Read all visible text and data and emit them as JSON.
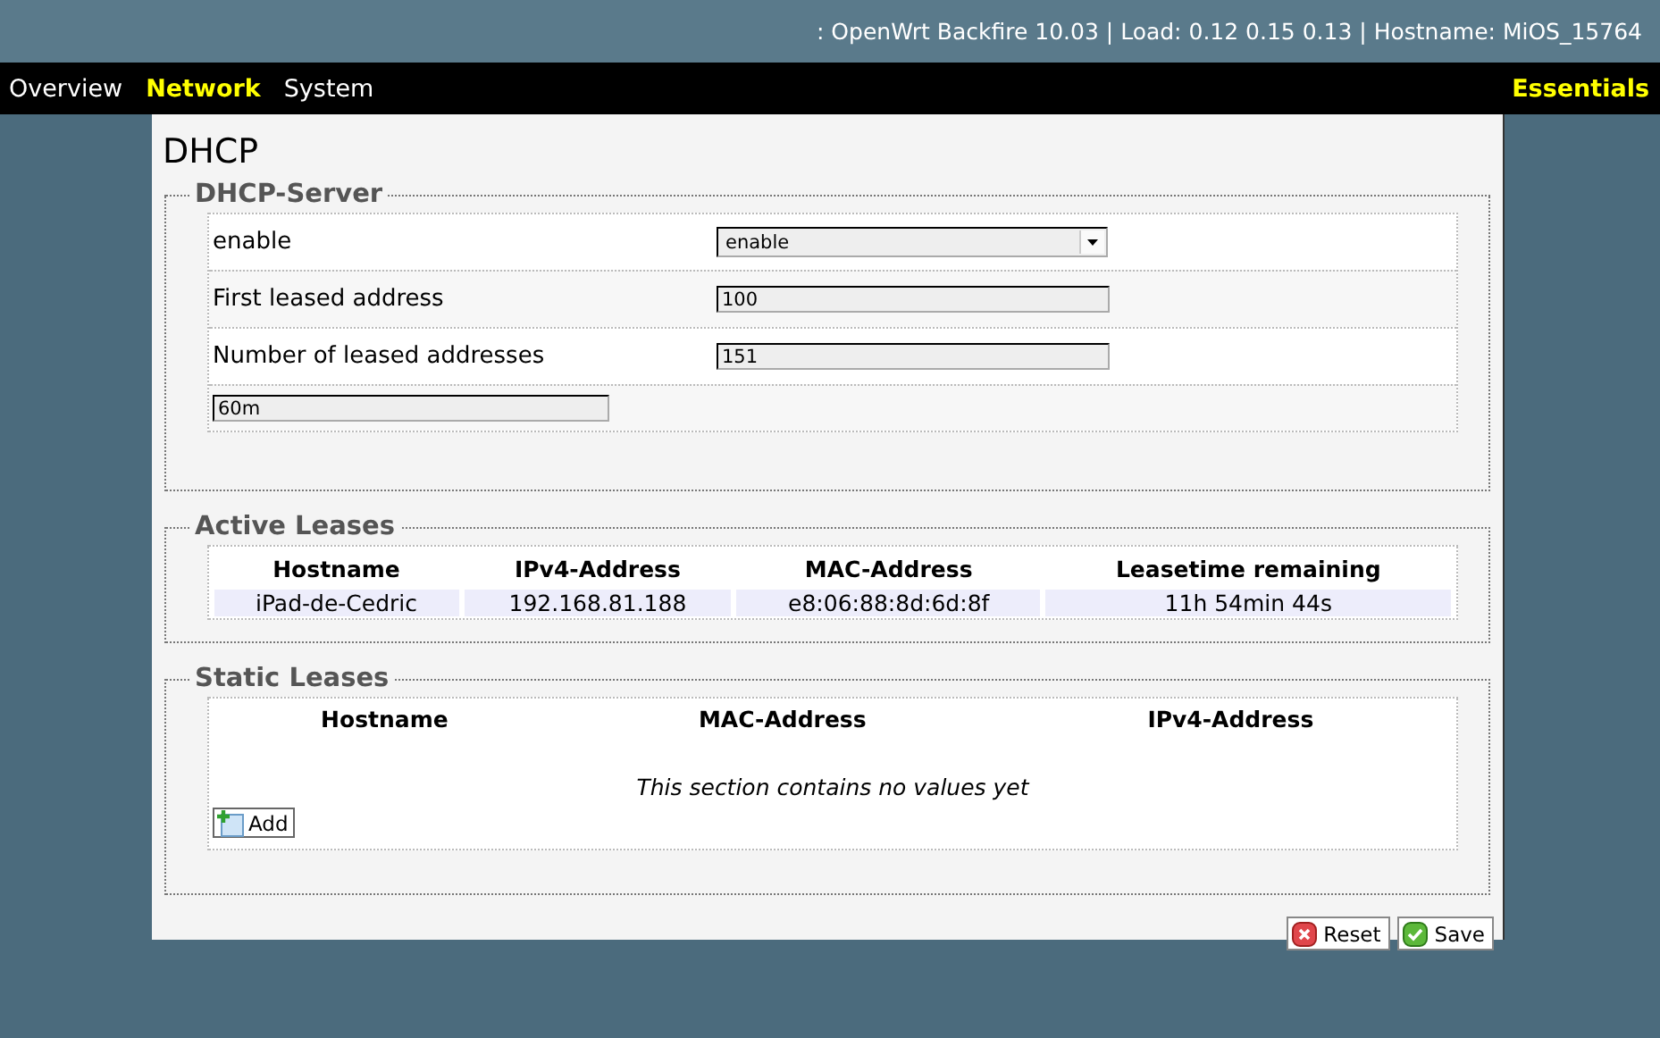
{
  "header": {
    "status": ": OpenWrt Backfire 10.03 | Load: 0.12 0.15 0.13 | Hostname: MiOS_15764"
  },
  "nav": {
    "items": [
      {
        "label": "Overview",
        "selected": false
      },
      {
        "label": "Network",
        "selected": true
      },
      {
        "label": "System",
        "selected": false
      }
    ],
    "mode": "Essentials"
  },
  "page": {
    "title": "DHCP"
  },
  "dhcp_server": {
    "legend": "DHCP-Server",
    "fields": [
      {
        "kind": "select",
        "label": "enable",
        "value": "enable"
      },
      {
        "kind": "text",
        "label": "First leased address",
        "value": "100"
      },
      {
        "kind": "text",
        "label": "Number of leased addresses",
        "value": "151"
      },
      {
        "kind": "text",
        "value": "60m"
      }
    ]
  },
  "active_leases": {
    "legend": "Active Leases",
    "columns": [
      "Hostname",
      "IPv4-Address",
      "MAC-Address",
      "Leasetime remaining"
    ],
    "rows": [
      [
        "iPad-de-Cedric",
        "192.168.81.188",
        "e8:06:88:8d:6d:8f",
        "11h 54min 44s"
      ]
    ]
  },
  "static_leases": {
    "legend": "Static Leases",
    "columns": [
      "Hostname",
      "MAC-Address",
      "IPv4-Address"
    ],
    "empty_message": "This section contains no values yet",
    "add_button": "Add"
  },
  "buttons": [
    {
      "kind": "reset",
      "label": "Reset"
    },
    {
      "kind": "save",
      "label": "Save"
    }
  ]
}
